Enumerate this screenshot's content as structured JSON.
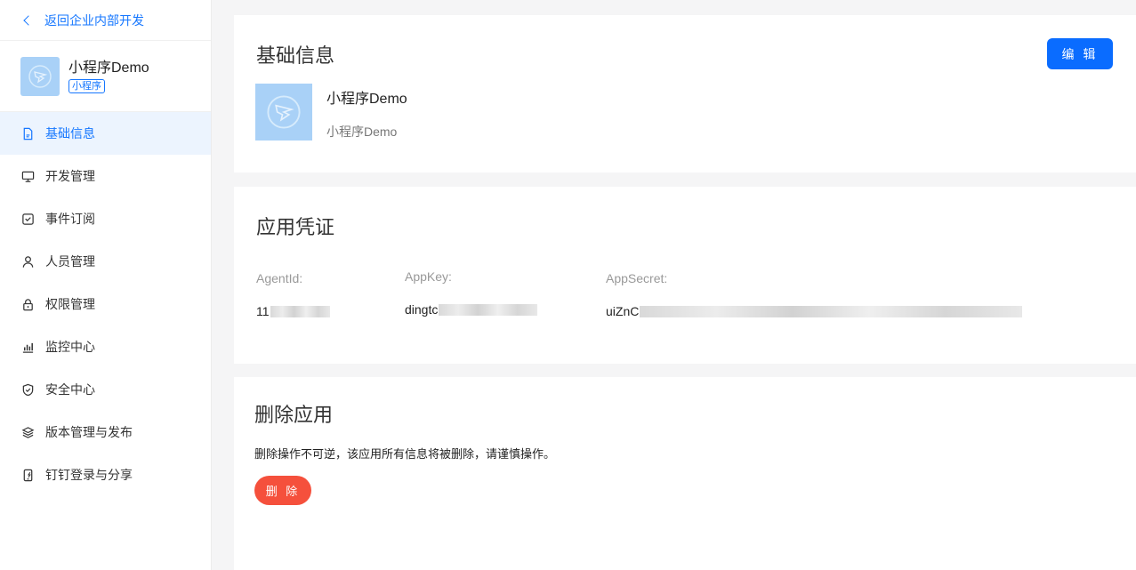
{
  "sidebar": {
    "back_label": "返回企业内部开发",
    "app_name": "小程序Demo",
    "app_tag": "小程序",
    "items": [
      {
        "label": "基础信息",
        "icon": "document-icon",
        "active": true
      },
      {
        "label": "开发管理",
        "icon": "monitor-icon",
        "active": false
      },
      {
        "label": "事件订阅",
        "icon": "subscribe-icon",
        "active": false
      },
      {
        "label": "人员管理",
        "icon": "user-icon",
        "active": false
      },
      {
        "label": "权限管理",
        "icon": "lock-icon",
        "active": false
      },
      {
        "label": "监控中心",
        "icon": "bar-chart-icon",
        "active": false
      },
      {
        "label": "安全中心",
        "icon": "shield-icon",
        "active": false
      },
      {
        "label": "版本管理与发布",
        "icon": "layers-icon",
        "active": false
      },
      {
        "label": "钉钉登录与分享",
        "icon": "phone-share-icon",
        "active": false
      }
    ]
  },
  "basic_info": {
    "title": "基础信息",
    "edit_label": "编 辑",
    "app_name": "小程序Demo",
    "app_desc": "小程序Demo"
  },
  "credentials": {
    "title": "应用凭证",
    "agent_id_label": "AgentId:",
    "agent_id_value": "11",
    "app_key_label": "AppKey:",
    "app_key_value": "dingtc",
    "app_secret_label": "AppSecret:",
    "app_secret_value": "uiZnC"
  },
  "delete_app": {
    "title": "删除应用",
    "warning": "删除操作不可逆，该应用所有信息将被删除，请谨慎操作。",
    "delete_label": "删 除"
  },
  "colors": {
    "primary": "#0a6cff",
    "danger": "#f5503c",
    "active_bg": "#ecf4fe",
    "logo_bg": "#a9d1f7"
  }
}
